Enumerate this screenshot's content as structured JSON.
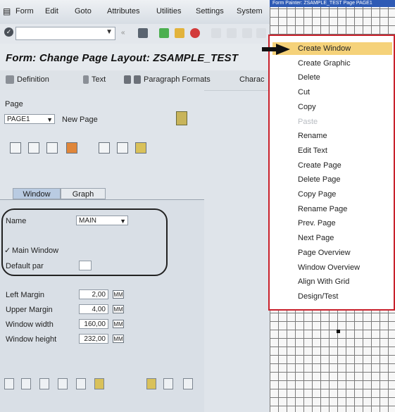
{
  "menubar": {
    "items": [
      "Form",
      "Edit",
      "Goto",
      "Attributes",
      "Utilities",
      "Settings",
      "System"
    ]
  },
  "window": {
    "title": "Form: Change Page Layout: ZSAMPLE_TEST"
  },
  "app_toolbar": {
    "buttons": [
      "Definition",
      "Text",
      "Paragraph Formats",
      "Charac"
    ]
  },
  "page_area": {
    "page_label": "Page",
    "page_value": "PAGE1",
    "new_page_label": "New Page"
  },
  "tabs": {
    "window": "Window",
    "graph": "Graph"
  },
  "window_tab": {
    "name_label": "Name",
    "name_value": "MAIN",
    "main_window_label": "Main Window",
    "main_window_checked": true,
    "default_par_label": "Default par",
    "left_margin_label": "Left Margin",
    "left_margin_value": "2,00",
    "upper_margin_label": "Upper Margin",
    "upper_margin_value": "4,00",
    "window_width_label": "Window width",
    "window_width_value": "160,00",
    "window_height_label": "Window height",
    "window_height_value": "232,00",
    "unit": "MM"
  },
  "graph_pane": {
    "title": "Form Painter: ZSAMPLE_TEST Page PAGE1"
  },
  "context_menu": {
    "items": [
      {
        "label": "Create Window",
        "highlighted": true,
        "disabled": false
      },
      {
        "label": "Create Graphic",
        "highlighted": false,
        "disabled": false
      },
      {
        "label": "Delete",
        "highlighted": false,
        "disabled": false
      },
      {
        "label": "Cut",
        "highlighted": false,
        "disabled": false
      },
      {
        "label": "Copy",
        "highlighted": false,
        "disabled": false
      },
      {
        "label": "Paste",
        "highlighted": false,
        "disabled": true
      },
      {
        "label": "Rename",
        "highlighted": false,
        "disabled": false
      },
      {
        "label": "Edit Text",
        "highlighted": false,
        "disabled": false
      },
      {
        "label": "Create Page",
        "highlighted": false,
        "disabled": false
      },
      {
        "label": "Delete Page",
        "highlighted": false,
        "disabled": false
      },
      {
        "label": "Copy Page",
        "highlighted": false,
        "disabled": false
      },
      {
        "label": "Rename Page",
        "highlighted": false,
        "disabled": false
      },
      {
        "label": "Prev. Page",
        "highlighted": false,
        "disabled": false
      },
      {
        "label": "Next Page",
        "highlighted": false,
        "disabled": false
      },
      {
        "label": "Page Overview",
        "highlighted": false,
        "disabled": false
      },
      {
        "label": "Window Overview",
        "highlighted": false,
        "disabled": false
      },
      {
        "label": "Align With Grid",
        "highlighted": false,
        "disabled": false
      },
      {
        "label": "Design/Test",
        "highlighted": false,
        "disabled": false
      }
    ]
  },
  "colors": {
    "menu_border": "#c8202b",
    "highlight": "#f5d27a",
    "title_bar": "#2f5bb5",
    "grid_line": "#7a7a7a"
  }
}
